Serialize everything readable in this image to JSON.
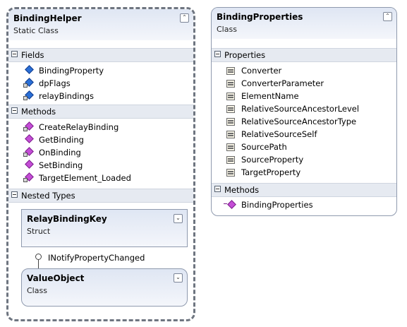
{
  "binding_helper": {
    "title": "BindingHelper",
    "subtitle": "Static Class",
    "fields_label": "Fields",
    "fields": [
      "BindingProperty",
      "dpFlags",
      "relayBindings"
    ],
    "methods_label": "Methods",
    "methods": [
      "CreateRelayBinding",
      "GetBinding",
      "OnBinding",
      "SetBinding",
      "TargetElement_Loaded"
    ],
    "nested_label": "Nested Types",
    "relay_key": {
      "title": "RelayBindingKey",
      "subtitle": "Struct"
    },
    "interface_label": "INotifyPropertyChanged",
    "value_object": {
      "title": "ValueObject",
      "subtitle": "Class"
    }
  },
  "binding_properties": {
    "title": "BindingProperties",
    "subtitle": "Class",
    "properties_label": "Properties",
    "properties": [
      "Converter",
      "ConverterParameter",
      "ElementName",
      "RelativeSourceAncestorLevel",
      "RelativeSourceAncestorType",
      "RelativeSourceSelf",
      "SourcePath",
      "SourceProperty",
      "TargetProperty"
    ],
    "methods_label": "Methods",
    "methods": [
      "BindingProperties"
    ]
  },
  "icons": {
    "collapse": "double-chevron-up-icon",
    "expand": "double-chevron-down-icon",
    "field": "field-icon",
    "method": "method-icon",
    "property": "property-icon"
  }
}
